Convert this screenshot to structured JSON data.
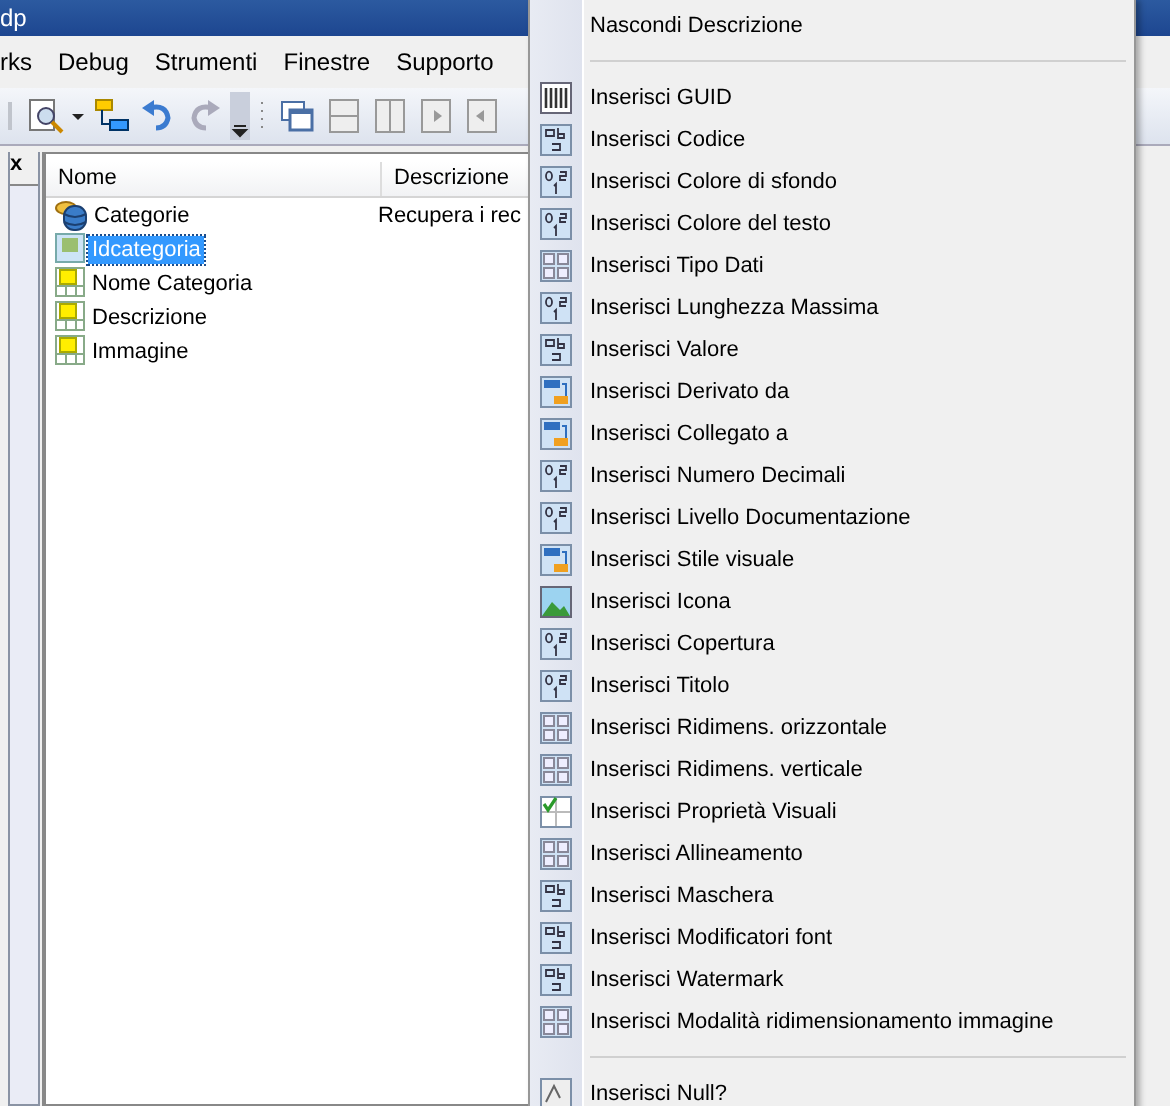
{
  "window": {
    "title": "dp"
  },
  "menu_bar": [
    "rks",
    "Debug",
    "Strumenti",
    "Finestre",
    "Supporto"
  ],
  "side_panel": {
    "close": "x"
  },
  "table": {
    "columns": [
      "Nome",
      "Descrizione"
    ],
    "rows": [
      {
        "kind": "table",
        "name": "Categorie",
        "description": "Recupera i rec",
        "selected": false
      },
      {
        "kind": "key",
        "name": "Idcategoria",
        "selected": true
      },
      {
        "kind": "field",
        "name": "Nome Categoria",
        "selected": false
      },
      {
        "kind": "field",
        "name": "Descrizione",
        "selected": false
      },
      {
        "kind": "field",
        "name": "Immagine",
        "selected": false
      }
    ]
  },
  "context_menu": {
    "items": [
      {
        "kind": "plain",
        "label": "Nascondi Descrizione"
      },
      {
        "kind": "separator"
      },
      {
        "kind": "barcode",
        "label": "Inserisci GUID"
      },
      {
        "kind": "text",
        "label": "Inserisci Codice"
      },
      {
        "kind": "number",
        "label": "Inserisci Colore di sfondo"
      },
      {
        "kind": "number",
        "label": "Inserisci Colore del testo"
      },
      {
        "kind": "grid",
        "label": "Inserisci Tipo Dati"
      },
      {
        "kind": "number",
        "label": "Inserisci Lunghezza Massima"
      },
      {
        "kind": "text",
        "label": "Inserisci Valore"
      },
      {
        "kind": "link",
        "label": "Inserisci Derivato da"
      },
      {
        "kind": "link",
        "label": "Inserisci Collegato a"
      },
      {
        "kind": "number",
        "label": "Inserisci Numero Decimali"
      },
      {
        "kind": "number",
        "label": "Inserisci Livello Documentazione"
      },
      {
        "kind": "link",
        "label": "Inserisci Stile visuale"
      },
      {
        "kind": "image",
        "label": "Inserisci Icona"
      },
      {
        "kind": "number",
        "label": "Inserisci Copertura"
      },
      {
        "kind": "number",
        "label": "Inserisci Titolo"
      },
      {
        "kind": "grid",
        "label": "Inserisci Ridimens. orizzontale"
      },
      {
        "kind": "grid",
        "label": "Inserisci Ridimens. verticale"
      },
      {
        "kind": "check",
        "label": "Inserisci Proprietà Visuali"
      },
      {
        "kind": "grid",
        "label": "Inserisci Allineamento"
      },
      {
        "kind": "text",
        "label": "Inserisci Maschera"
      },
      {
        "kind": "text",
        "label": "Inserisci Modificatori font"
      },
      {
        "kind": "text",
        "label": "Inserisci Watermark"
      },
      {
        "kind": "grid",
        "label": "Inserisci Modalità ridimensionamento immagine"
      },
      {
        "kind": "separator"
      },
      {
        "kind": "null",
        "label": "Inserisci Null?"
      }
    ]
  }
}
